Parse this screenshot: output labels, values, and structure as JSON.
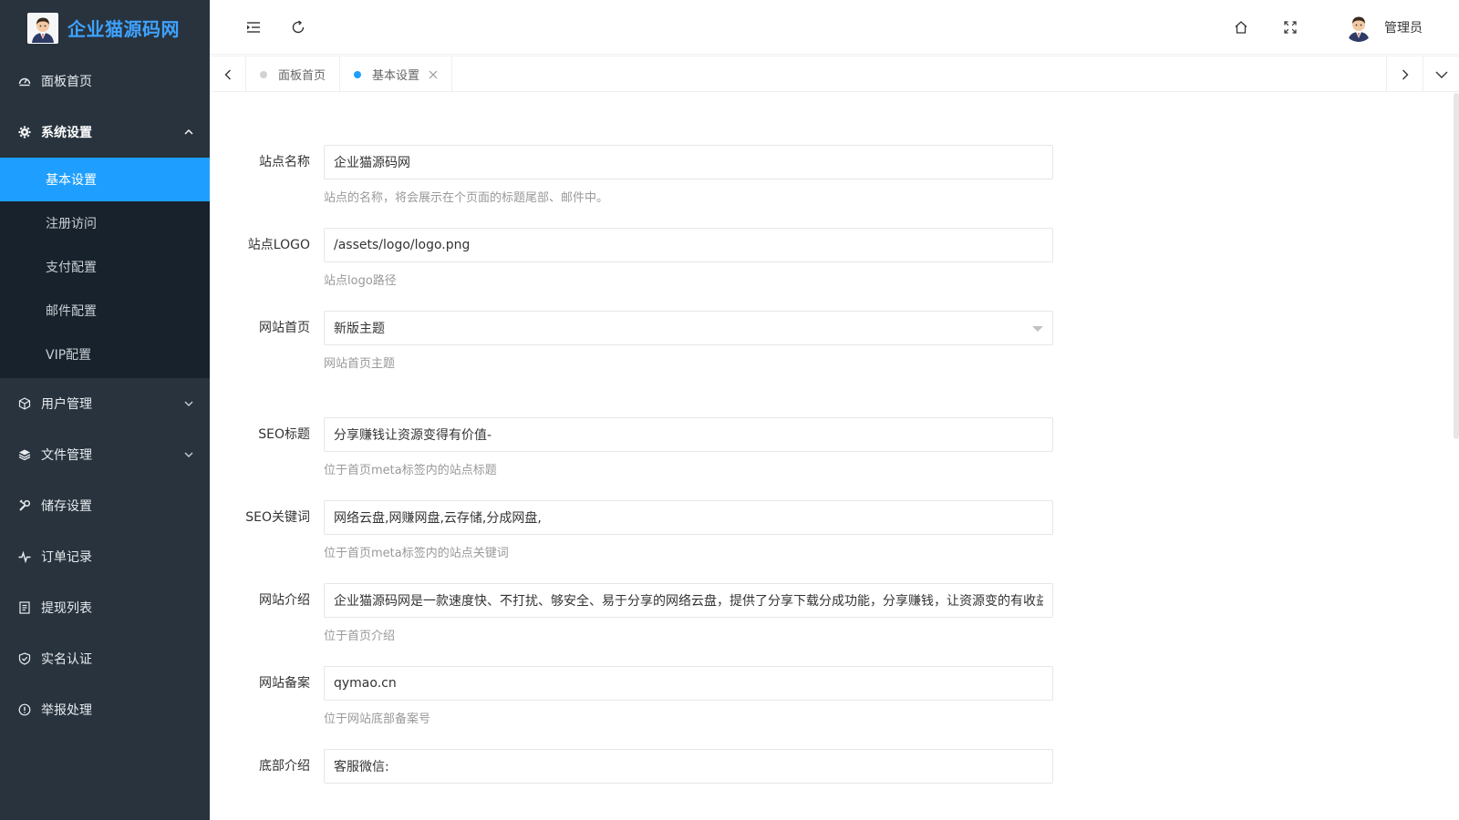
{
  "brand": {
    "name": "企业猫源码网"
  },
  "sidebar": {
    "items": [
      {
        "label": "面板首页",
        "icon": "dashboard-icon"
      },
      {
        "label": "系统设置",
        "icon": "gear-icon",
        "open": true
      },
      {
        "label": "用户管理",
        "icon": "cube-icon"
      },
      {
        "label": "文件管理",
        "icon": "layers-icon"
      },
      {
        "label": "储存设置",
        "icon": "tools-icon"
      },
      {
        "label": "订单记录",
        "icon": "pulse-icon"
      },
      {
        "label": "提现列表",
        "icon": "list-icon"
      },
      {
        "label": "实名认证",
        "icon": "shield-check-icon"
      },
      {
        "label": "举报处理",
        "icon": "alert-circle-icon"
      }
    ],
    "system_submenu": [
      "基本设置",
      "注册访问",
      "支付配置",
      "邮件配置",
      "VIP配置"
    ],
    "active_sub": "基本设置"
  },
  "header": {
    "user_name": "管理员"
  },
  "tabs": [
    {
      "label": "面板首页",
      "active": false
    },
    {
      "label": "基本设置",
      "active": true
    }
  ],
  "form": {
    "site_name": {
      "label": "站点名称",
      "value": "企业猫源码网",
      "hint": "站点的名称，将会展示在个页面的标题尾部、邮件中。"
    },
    "site_logo": {
      "label": "站点LOGO",
      "value": "/assets/logo/logo.png",
      "hint": "站点logo路径"
    },
    "homepage": {
      "label": "网站首页",
      "value": "新版主题",
      "hint": "网站首页主题"
    },
    "seo_title": {
      "label": "SEO标题",
      "value": "分享赚钱让资源变得有价值-",
      "hint": "位于首页meta标签内的站点标题"
    },
    "seo_keywords": {
      "label": "SEO关键词",
      "value": "网络云盘,网赚网盘,云存储,分成网盘,",
      "hint": "位于首页meta标签内的站点关键词"
    },
    "site_intro": {
      "label": "网站介绍",
      "value": "企业猫源码网是一款速度快、不打扰、够安全、易于分享的网络云盘，提供了分享下载分成功能，分享赚钱，让资源变的有收益价值",
      "hint": "位于首页介绍"
    },
    "icp": {
      "label": "网站备案",
      "value": "qymao.cn",
      "hint": "位于网站底部备案号"
    },
    "footer": {
      "label": "底部介绍",
      "value": "客服微信:"
    }
  },
  "colors": {
    "sidebar_bg": "#28333e",
    "submenu_bg": "#18222c",
    "accent": "#1e9fff",
    "brand_text": "#3ea2ff"
  }
}
